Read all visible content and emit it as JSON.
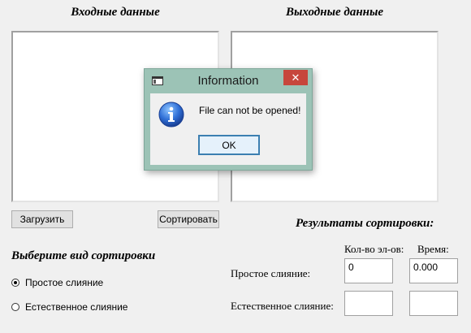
{
  "input_section": {
    "title": "Входные данные",
    "load_button": "Загрузить",
    "sort_button": "Сортировать"
  },
  "output_section": {
    "title": "Выходные данные"
  },
  "sort_type": {
    "title": "Выберите вид сортировки",
    "options": [
      {
        "label": "Простое слияние",
        "checked": true
      },
      {
        "label": "Естественное слияние",
        "checked": false
      }
    ]
  },
  "results": {
    "title": "Результаты сортировки:",
    "col_count": "Кол-во эл-ов:",
    "col_time": "Время:",
    "rows": [
      {
        "label": "Простое слияние:",
        "count": "0",
        "time": "0.000"
      },
      {
        "label": "Естественное слияние:",
        "count": "",
        "time": ""
      }
    ]
  },
  "dialog": {
    "title": "Information",
    "message": "File can not be opened!",
    "ok_label": "OK",
    "close_glyph": "✕",
    "icon": "info-icon",
    "window_icon": "window-icon",
    "accent_color": "#9cc3b6",
    "close_color": "#c7463c"
  }
}
